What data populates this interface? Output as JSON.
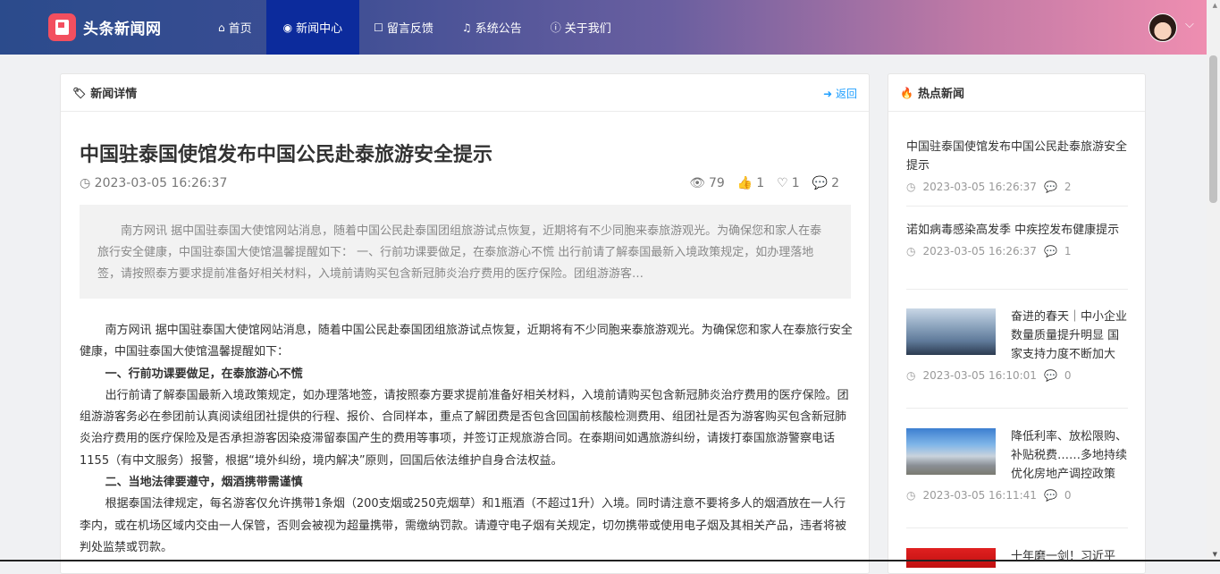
{
  "header": {
    "brand": "头条新闻网",
    "nav": [
      {
        "label": "首页",
        "icon": "home-icon",
        "glyph": "⌂"
      },
      {
        "label": "新闻中心",
        "icon": "globe-icon",
        "glyph": "◉"
      },
      {
        "label": "留言反馈",
        "icon": "chat-icon",
        "glyph": "☐"
      },
      {
        "label": "系统公告",
        "icon": "bell-icon",
        "glyph": "♫"
      },
      {
        "label": "关于我们",
        "icon": "info-icon",
        "glyph": "ⓘ"
      }
    ],
    "active_nav": "新闻中心",
    "user_caret": "⌵"
  },
  "main": {
    "section_title": "新闻详情",
    "back_label": "返回",
    "title": "中国驻泰国使馆发布中国公民赴泰旅游安全提示",
    "date": "2023-03-05 16:26:37",
    "views": "79",
    "likes": "1",
    "favorites": "1",
    "comments": "2",
    "summary": "南方网讯 据中国驻泰国大使馆网站消息，随着中国公民赴泰国团组旅游试点恢复，近期将有不少同胞来泰旅游观光。为确保您和家人在泰旅行安全健康，中国驻泰国大使馆温馨提醒如下：         一、行前功课要做足，在泰旅游心不慌         出行前请了解泰国最新入境政策规定，如办理落地签，请按照泰方要求提前准备好相关材料，入境前请购买包含新冠肺炎治疗费用的医疗保险。团组游游客…",
    "paragraphs": [
      {
        "text": "南方网讯 据中国驻泰国大使馆网站消息，随着中国公民赴泰国团组旅游试点恢复，近期将有不少同胞来泰旅游观光。为确保您和家人在泰旅行安全健康，中国驻泰国大使馆温馨提醒如下：",
        "bold": false
      },
      {
        "text": "一、行前功课要做足，在泰旅游心不慌",
        "bold": true
      },
      {
        "text": "出行前请了解泰国最新入境政策规定，如办理落地签，请按照泰方要求提前准备好相关材料，入境前请购买包含新冠肺炎治疗费用的医疗保险。团组游游客务必在参团前认真阅读组团社提供的行程、报价、合同样本，重点了解团费是否包含回国前核酸检测费用、组团社是否为游客购买包含新冠肺炎治疗费用的医疗保险及是否承担游客因染疫滞留泰国产生的费用等事项，并签订正规旅游合同。在泰期间如遇旅游纠纷，请拨打泰国旅游警察电话1155（有中文服务）报警，根据“境外纠纷，境内解决”原则，回国后依法维护自身合法权益。",
        "bold": false
      },
      {
        "text": "二、当地法律要遵守，烟酒携带需谨慎",
        "bold": true
      },
      {
        "text": "根据泰国法律规定，每名游客仅允许携带1条烟（200支烟或250克烟草）和1瓶酒（不超过1升）入境。同时请注意不要将多人的烟酒放在一人行李内，或在机场区域内交由一人保管，否则会被视为超量携带，需缴纳罚款。请遵守电子烟有关规定，切勿携带或使用电子烟及其相关产品，违者将被判处监禁或罚款。",
        "bold": false
      }
    ]
  },
  "side": {
    "section_title": "热点新闻",
    "items": [
      {
        "title": "中国驻泰国使馆发布中国公民赴泰旅游安全提示",
        "date": "2023-03-05 16:26:37",
        "comments": "2"
      },
      {
        "title": "诺如病毒感染高发季 中疾控发布健康提示",
        "date": "2023-03-05 16:26:37",
        "comments": "1"
      },
      {
        "title": "奋进的春天｜中小企业数量质量提升明显 国家支持力度不断加大",
        "date": "2023-03-05 16:10:01",
        "comments": "0"
      },
      {
        "title": "降低利率、放松限购、补贴税费……多地持续优化房地产调控政策",
        "date": "2023-03-05 16:11:41",
        "comments": "0"
      },
      {
        "title": "十年磨一剑！习近平",
        "date": "",
        "comments": ""
      }
    ]
  }
}
